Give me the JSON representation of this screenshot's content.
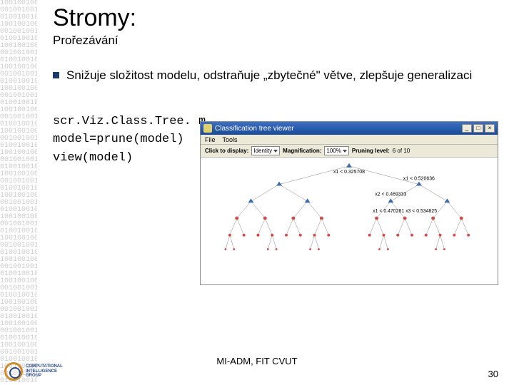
{
  "title": "Stromy:",
  "subtitle": "Prořezávání",
  "bullet": "Snižuje složitost modelu, odstraňuje „zbytečné\" větve, zlepšuje generalizaci",
  "code": {
    "line1": "scr.Viz.Class.Tree. m",
    "line2": "model=prune(model)",
    "line3": "view(model)"
  },
  "viewer": {
    "title": "Classification tree viewer",
    "menu": {
      "file": "File",
      "tools": "Tools"
    },
    "toolbar": {
      "click_label": "Click to display:",
      "click_value": "Identity",
      "mag_label": "Magnification:",
      "mag_value": "100%",
      "prune_label": "Pruning level:",
      "prune_value": "6 of 10"
    },
    "window_buttons": {
      "min": "_",
      "max": "□",
      "close": "×"
    },
    "nodes": {
      "root": "x1 < 0.325708",
      "r2a": "x1 < 0.520636",
      "r2b": "x2 < 0.469333",
      "r3": "x1 < 0.470281   x3 < 0.534825"
    },
    "tree_levels": 6,
    "branching": 2
  },
  "footer": "MI-ADM, FIT CVUT",
  "page_number": "30",
  "logo_text": {
    "l1": "COMPUTATIONAL",
    "l2": "INTELLIGENCE",
    "l3": "GROUP"
  },
  "binary_rows": 54
}
